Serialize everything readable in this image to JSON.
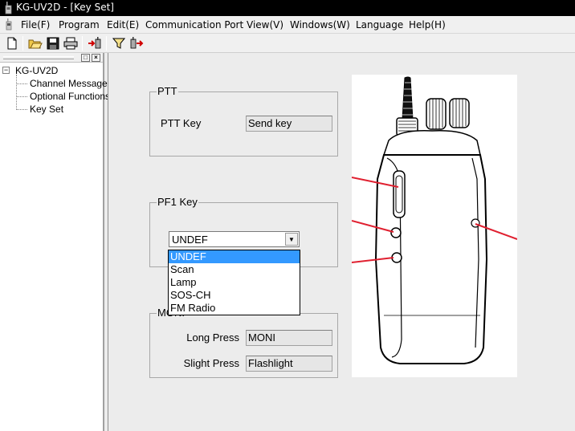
{
  "window": {
    "title": "KG-UV2D - [Key Set]"
  },
  "menu": {
    "items": [
      {
        "label": "File(F)"
      },
      {
        "label": "Program"
      },
      {
        "label": "Edit(E)"
      },
      {
        "label": "Communication Port"
      },
      {
        "label": "View(V)"
      },
      {
        "label": "Windows(W)"
      },
      {
        "label": "Language"
      },
      {
        "label": "Help(H)"
      }
    ]
  },
  "toolbar": {
    "buttons": [
      {
        "icon": "new-file-icon"
      },
      {
        "icon": "open-folder-icon"
      },
      {
        "icon": "save-icon"
      },
      {
        "icon": "print-icon"
      },
      {
        "icon": "read-from-radio-icon"
      },
      {
        "icon": "filter-icon"
      },
      {
        "icon": "write-to-radio-icon"
      }
    ]
  },
  "tree": {
    "root": "KG-UV2D",
    "children": [
      {
        "label": "Channel Message"
      },
      {
        "label": "Optional Functions"
      },
      {
        "label": "Key Set"
      }
    ]
  },
  "ptt": {
    "group_title": "PTT",
    "key_label": "PTT Key",
    "key_value": "Send key"
  },
  "pf1": {
    "group_title": "PF1 Key",
    "selected": "UNDEF",
    "options": [
      "UNDEF",
      "Scan",
      "Lamp",
      "SOS-CH",
      "FM Radio"
    ]
  },
  "moni": {
    "group_title": "MONI",
    "long_press_label": "Long Press",
    "long_press_value": "MONI",
    "slight_press_label": "Slight Press",
    "slight_press_value": "Flashlight"
  },
  "colors": {
    "titlebar": "#000000",
    "selection": "#3399ff",
    "callout_line": "#e02030"
  }
}
